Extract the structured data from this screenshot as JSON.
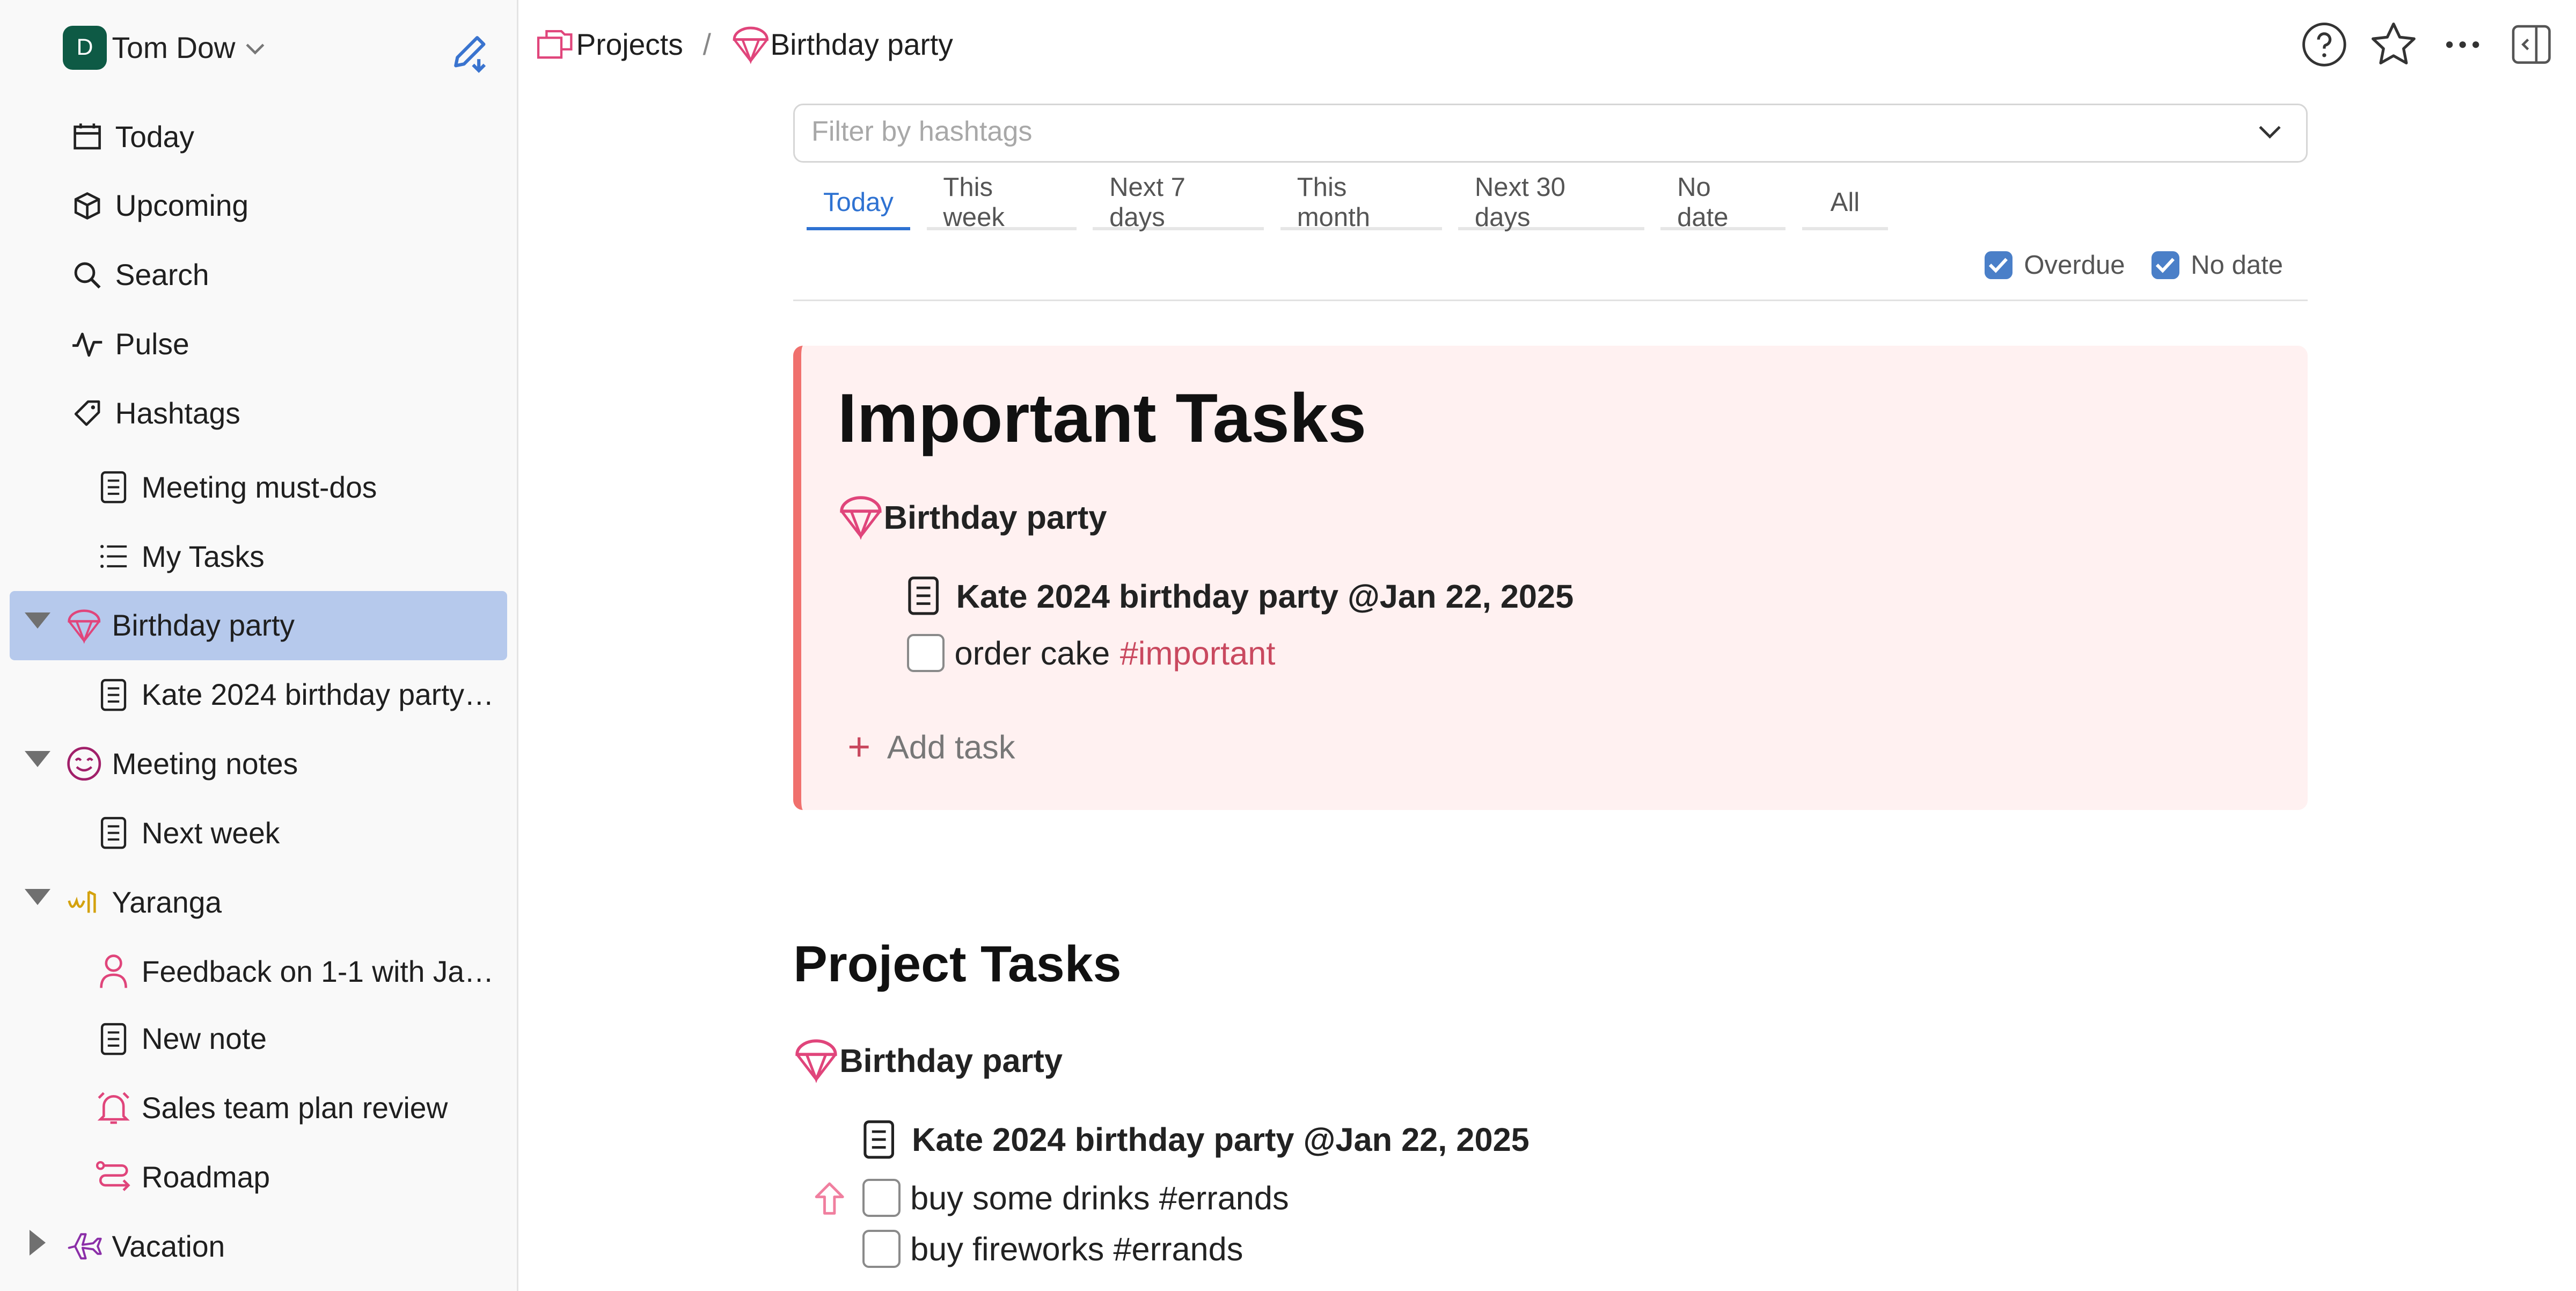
{
  "user": {
    "initial": "D",
    "name": "Tom Dow"
  },
  "sidebar": {
    "nav": [
      {
        "label": "Today",
        "icon": "calendar-icon"
      },
      {
        "label": "Upcoming",
        "icon": "upcoming-icon"
      },
      {
        "label": "Search",
        "icon": "search-icon"
      },
      {
        "label": "Pulse",
        "icon": "pulse-icon"
      },
      {
        "label": "Hashtags",
        "icon": "tag-icon"
      }
    ],
    "tree": [
      {
        "label": "Meeting must-dos",
        "icon": "note-icon"
      },
      {
        "label": "My Tasks",
        "icon": "list-icon"
      },
      {
        "label": "Birthday party",
        "icon": "balloon-icon"
      },
      {
        "label": "Kate 2024 birthday party…",
        "icon": "note-icon"
      },
      {
        "label": "Meeting notes",
        "icon": "smile-icon"
      },
      {
        "label": "Next week",
        "icon": "note-icon"
      },
      {
        "label": "Yaranga",
        "icon": "yaranga-icon"
      },
      {
        "label": "Feedback on 1-1 with Ja…",
        "icon": "person-icon"
      },
      {
        "label": "New note",
        "icon": "note-icon"
      },
      {
        "label": "Sales team plan review",
        "icon": "alarm-icon"
      },
      {
        "label": "Roadmap",
        "icon": "route-icon"
      },
      {
        "label": "Vacation",
        "icon": "plane-icon"
      }
    ]
  },
  "breadcrumb": {
    "root": "Projects",
    "separator": "/",
    "current": "Birthday party"
  },
  "filter": {
    "placeholder": "Filter by hashtags"
  },
  "tabs": [
    "Today",
    "This week",
    "Next 7 days",
    "This month",
    "Next 30 days",
    "No date",
    "All"
  ],
  "checks": {
    "overdue": "Overdue",
    "nodate": "No date"
  },
  "important": {
    "title": "Important Tasks",
    "project": "Birthday party",
    "note": "Kate 2024 birthday party @Jan 22, 2025",
    "task_text": "order cake",
    "task_tag": "#important",
    "add_task": "Add task"
  },
  "project_tasks": {
    "title": "Project Tasks",
    "project": "Birthday party",
    "note": "Kate 2024 birthday party @Jan 22, 2025",
    "tasks": [
      "buy some drinks #errands",
      "buy fireworks #errands"
    ]
  },
  "colors": {
    "accent": "#2e72d2",
    "pink": "#e0457b",
    "selected": "#b6c9ec",
    "card_bg": "#fff1f1",
    "card_border": "#f0706d"
  }
}
